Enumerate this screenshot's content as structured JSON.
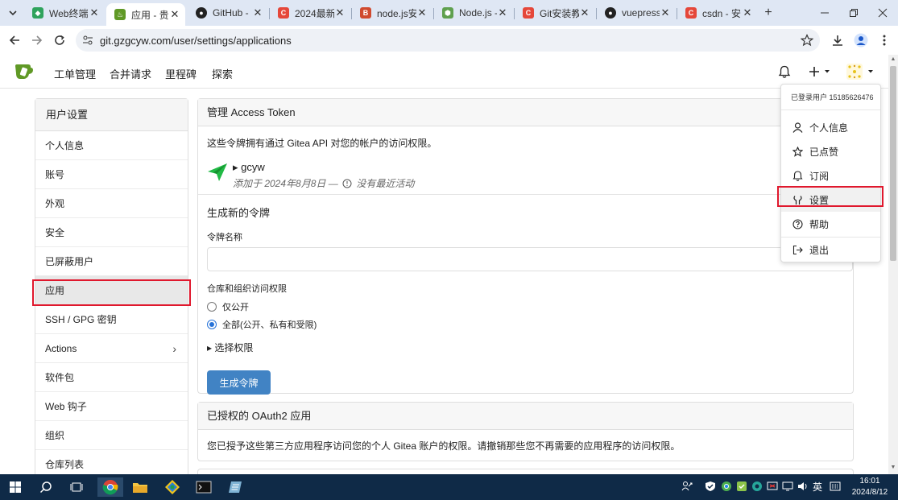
{
  "browser": {
    "tabs": [
      {
        "title": "Web终端",
        "fav_color": "#2fa35c",
        "fav_glyph": "◆"
      },
      {
        "title": "应用 - 贵州",
        "fav_color": "#609926",
        "fav_glyph": "♨"
      },
      {
        "title": "GitHub -",
        "fav_color": "#222222",
        "fav_glyph": "●"
      },
      {
        "title": "2024最新",
        "fav_color": "#e5473a",
        "fav_glyph": "C"
      },
      {
        "title": "node.js安",
        "fav_color": "#d04a2f",
        "fav_glyph": "B"
      },
      {
        "title": "Node.js -",
        "fav_color": "#5fa04e",
        "fav_glyph": "⬢"
      },
      {
        "title": "Git安装教",
        "fav_color": "#e5473a",
        "fav_glyph": "C"
      },
      {
        "title": "vuepress",
        "fav_color": "#222222",
        "fav_glyph": "●"
      },
      {
        "title": "csdn - 安",
        "fav_color": "#e5473a",
        "fav_glyph": "C"
      }
    ],
    "active_tab": 1,
    "url": "git.gzgcyw.com/user/settings/applications"
  },
  "gitea": {
    "nav": [
      "工单管理",
      "合并请求",
      "里程碑",
      "探索"
    ]
  },
  "sidebar": {
    "header": "用户设置",
    "items": [
      {
        "label": "个人信息"
      },
      {
        "label": "账号"
      },
      {
        "label": "外观"
      },
      {
        "label": "安全"
      },
      {
        "label": "已屏蔽用户"
      },
      {
        "label": "应用"
      },
      {
        "label": "SSH / GPG 密钥"
      },
      {
        "label": "Actions"
      },
      {
        "label": "软件包"
      },
      {
        "label": "Web 钩子"
      },
      {
        "label": "组织"
      },
      {
        "label": "仓库列表"
      }
    ],
    "active_index": 5
  },
  "tokens_panel": {
    "title_prefix": "管理 ",
    "title_strong": "Access Token",
    "description": "这些令牌拥有通过 Gitea API 对您的帐户的访问权限。",
    "token": {
      "name": "▸ gcyw",
      "added": "添加于 2024年8月8日 —",
      "activity": "没有最近活动"
    },
    "new_section_title": "生成新的令牌",
    "name_label": "令牌名称",
    "name_value": "",
    "scope_label": "仓库和组织访问权限",
    "scope_options": [
      {
        "label": "仅公开",
        "selected": false
      },
      {
        "label": "全部(公开、私有和受限)",
        "selected": true
      }
    ],
    "select_permissions": "▸ 选择权限",
    "generate_button": "生成令牌"
  },
  "oauth_panel": {
    "title_prefix": "已授权的 ",
    "title_strong": "OAuth2",
    "title_suffix": " 应用",
    "description": "您已授予这些第三方应用程序访问您的个人 Gitea 账户的权限。请撤销那些您不再需要的应用程序的访问权限。"
  },
  "user_menu": {
    "header": "已登录用户 15185626476",
    "items": [
      {
        "label": "个人信息",
        "icon": "person-icon"
      },
      {
        "label": "已点赞",
        "icon": "star-icon"
      },
      {
        "label": "订阅",
        "icon": "bell-icon"
      },
      {
        "label": "设置",
        "icon": "tools-icon"
      },
      {
        "label": "帮助",
        "icon": "question-icon"
      },
      {
        "label": "退出",
        "icon": "sign-out-icon"
      }
    ],
    "highlighted_index": 3
  },
  "taskbar": {
    "ime": "英",
    "time": "16:01",
    "date": "2024/8/12"
  },
  "colors": {
    "highlight_box": "#e0182d",
    "primary_button": "#4183c4",
    "danger": "#d1242f",
    "gitea_green": "#609926"
  }
}
